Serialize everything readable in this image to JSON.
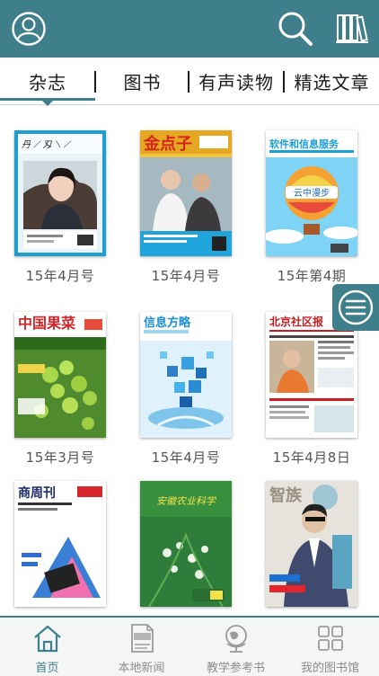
{
  "header": {
    "profile_icon": "user-icon",
    "search_icon": "search-icon",
    "library_icon": "bookshelf-icon"
  },
  "tabs": [
    {
      "label": "杂志",
      "active": true
    },
    {
      "label": "图书",
      "active": false
    },
    {
      "label": "有声读物",
      "active": false
    },
    {
      "label": "精选文章",
      "active": false
    }
  ],
  "magazines": [
    {
      "title_art": "",
      "caption": "15年4月号"
    },
    {
      "title_art": "金点子",
      "caption": "15年4月号"
    },
    {
      "title_art": "软件和信息服务",
      "subtitle_art": "云中漫步",
      "caption": "15年第4期"
    },
    {
      "title_art": "中国果菜",
      "caption": "15年3月号"
    },
    {
      "title_art": "信息方略",
      "caption": "15年4月号"
    },
    {
      "title_art": "北京社区报",
      "caption": "15年4月8日"
    },
    {
      "title_art": "商周刊",
      "caption": ""
    },
    {
      "title_art": "安徽农业科学",
      "caption": ""
    },
    {
      "title_art": "智族",
      "caption": ""
    }
  ],
  "float_menu_icon": "menu-lines-icon",
  "bottom_nav": [
    {
      "label": "首页",
      "icon": "home-icon",
      "active": true
    },
    {
      "label": "本地新闻",
      "icon": "news-icon",
      "active": false
    },
    {
      "label": "教学参考书",
      "icon": "globe-icon",
      "active": false
    },
    {
      "label": "我的图书馆",
      "icon": "grid-icon",
      "active": false
    }
  ],
  "colors": {
    "accent": "#3e7f8b",
    "inactive": "#8c8c8c"
  }
}
